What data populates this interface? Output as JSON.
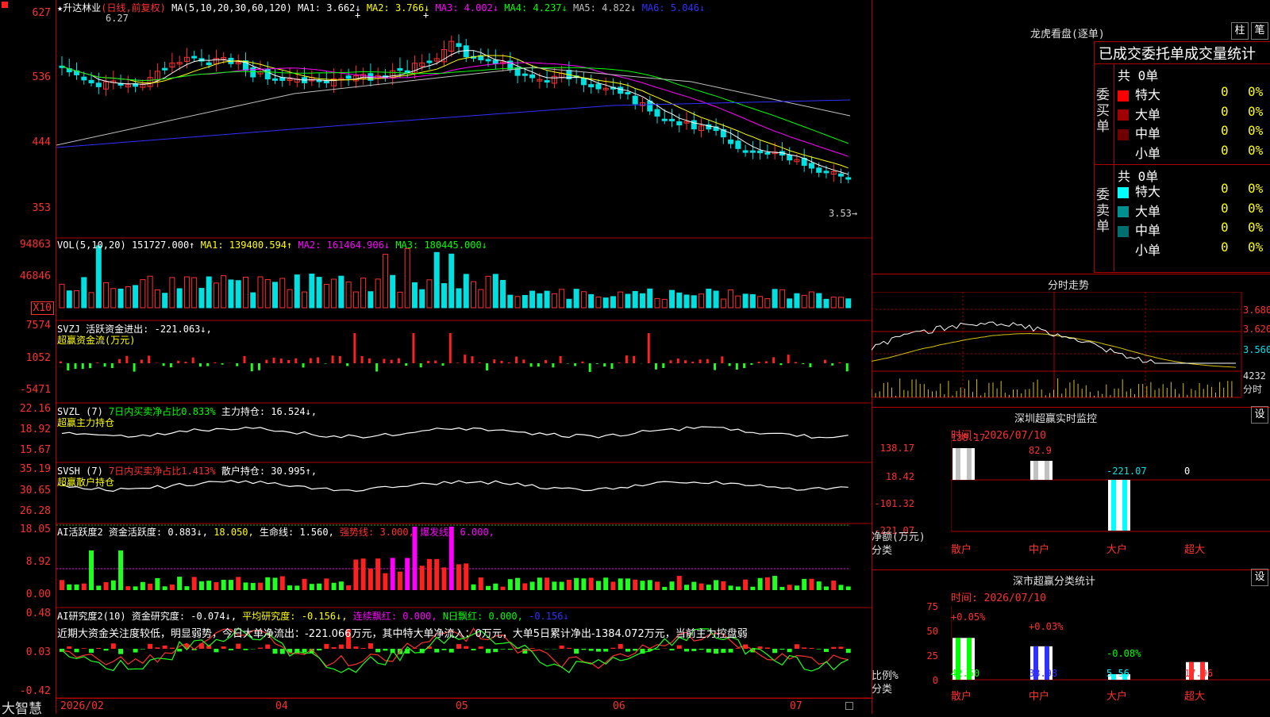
{
  "stock": {
    "name": "★升达林业",
    "mode": "(日线,前复权)",
    "ma_label": "MA(5,10,20,30,60,120)",
    "ma1": "MA1: 3.662↓",
    "ma2": "MA2: 3.766↓",
    "ma3": "MA3: 4.002↓",
    "ma4": "MA4: 4.237↓",
    "ma5": "MA5: 4.822↓",
    "ma6": "MA6: 5.046↓",
    "high_mark": "6.27",
    "low_mark": "3.53→",
    "price_ticks": [
      "627",
      "536",
      "444",
      "353"
    ],
    "marker_icons": [
      "+",
      "+"
    ]
  },
  "vol": {
    "label": "VOL(5,10,20)",
    "v": "151727.000↑",
    "ma1": "MA1: 139400.594↑",
    "ma2": "MA2: 161464.906↓",
    "ma3": "MA3: 180445.000↓",
    "ticks": [
      "94863",
      "46846"
    ],
    "unit": "X10"
  },
  "svzj": {
    "label": "SVZJ",
    "text": "活跃资金进出: -221.063↓,",
    "sub": "超赢资金流(万元)",
    "ticks": [
      "7574",
      "1052",
      "-5471"
    ]
  },
  "svzl": {
    "label": "SVZL (7)",
    "a": "7日内买卖净占比0.833%",
    "b": "主力持仓: 16.524↓,",
    "sub": "超赢主力持仓",
    "ticks": [
      "22.16",
      "18.92",
      "15.67"
    ]
  },
  "svsh": {
    "label": "SVSH (7)",
    "a": "7日内买卖净占比1.413%",
    "b": "散户持仓: 30.995↑,",
    "sub": "超赢散户持仓",
    "ticks": [
      "35.19",
      "30.65",
      "26.28"
    ]
  },
  "ai1": {
    "label": "AI活跃度2",
    "a": "资金活跃度: 0.883↓,",
    "b": "18.050,",
    "c": "生命线: 1.560,",
    "d": "强势线: 3.000,",
    "e": "爆发线: 6.000,",
    "ticks": [
      "18.05",
      "8.92",
      "0.00"
    ]
  },
  "ai2": {
    "label": "AI研究度2(10)",
    "a": "资金研究度: -0.074↓,",
    "b": "平均研究度: -0.156↓,",
    "c": "连续飘红: 0.000,",
    "d": "N日飘红: 0.000,",
    "e": "-0.156↓",
    "note": "近期大资金关注度较低，明显弱势，今日大单净流出：-221.066万元，其中特大单净流入：0万元，大单5日累计净出-1384.072万元，当前主力控盘弱",
    "ticks": [
      "0.48",
      "0.03",
      "-0.42"
    ]
  },
  "xaxis": [
    "2026/02",
    "04",
    "05",
    "06",
    "07"
  ],
  "brand": "大智慧",
  "lhb": {
    "title": "龙虎看盘(逐单)",
    "btn_zhu": "柱",
    "btn_bi": "笔",
    "subtitle": "已成交委托单成交量统计",
    "buy_side": "委买单",
    "sell_side": "委卖单",
    "buy_total": "共 0单",
    "sell_total": "共 0单",
    "buy_rows": [
      {
        "label": "特大",
        "n": "0",
        "p": "0%",
        "color": "#ff0000"
      },
      {
        "label": "大单",
        "n": "0",
        "p": "0%",
        "color": "#a00000"
      },
      {
        "label": "中单",
        "n": "0",
        "p": "0%",
        "color": "#700000"
      },
      {
        "label": "小单",
        "n": "0",
        "p": "0%",
        "color": "#000000"
      }
    ],
    "sell_rows": [
      {
        "label": "特大",
        "n": "0",
        "p": "0%",
        "color": "#00ffff"
      },
      {
        "label": "大单",
        "n": "0",
        "p": "0%",
        "color": "#009090"
      },
      {
        "label": "中单",
        "n": "0",
        "p": "0%",
        "color": "#006f70"
      },
      {
        "label": "小单",
        "n": "0",
        "p": "0%",
        "color": "#000000"
      }
    ]
  },
  "intraday": {
    "title": "分时走势",
    "ticks": [
      "3.680",
      "3.620",
      "3.560"
    ],
    "vol_tick": "4232",
    "vol_unit": "分时"
  },
  "sz_monitor": {
    "title": "深圳超赢实时监控",
    "btn": "设",
    "time": "时间: 2026/07/10",
    "yticks": [
      "138.17",
      "18.42",
      "-101.32",
      "-221.07"
    ],
    "ylabel1": "净额(万元)",
    "ylabel2": "分类",
    "cats": [
      "散户",
      "中户",
      "大户",
      "超大"
    ],
    "bar_labels": [
      "138.17",
      "82.9",
      "-221.07",
      "0"
    ]
  },
  "sz_class": {
    "title": "深市超赢分类统计",
    "btn": "设",
    "time": "时间: 2026/07/10",
    "yticks": [
      "75",
      "50",
      "25",
      "0"
    ],
    "ylabel1": "比例%",
    "ylabel2": "分类",
    "cats": [
      "散户",
      "中户",
      "大户",
      "超大"
    ],
    "change_labels": [
      "+0.05%",
      "+0.03%",
      "-0.08%",
      ""
    ],
    "values": [
      "42.50",
      "33.98",
      "5.56",
      "17.96"
    ],
    "pct": [
      42.5,
      33.98,
      5.56,
      17.96
    ]
  },
  "colors": {
    "up": "#ff3030",
    "down": "#00e0e0",
    "ma1": "#ffffff",
    "ma2": "#ffff00",
    "ma3": "#ff00ff",
    "ma4": "#00ff00",
    "ma5": "#c0c0c0",
    "ma6": "#3030ff",
    "frame": "#b00000"
  }
}
